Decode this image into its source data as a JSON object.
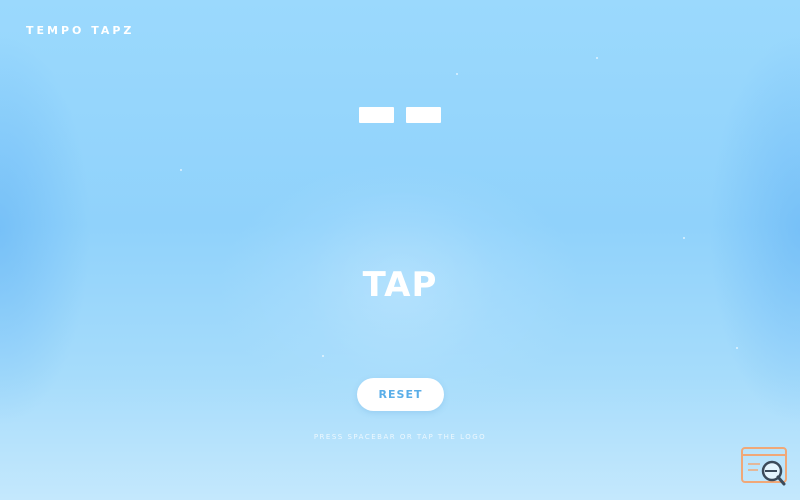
{
  "app": {
    "brand": "TEMPO TAPZ"
  },
  "display": {
    "digits": [
      "",
      ""
    ]
  },
  "tap": {
    "label": "TAP"
  },
  "controls": {
    "reset_label": "RESET"
  },
  "footer": {
    "hint": "PRESS SPACEBAR OR TAP THE LOGO"
  },
  "colors": {
    "background_top": "#9bd9fd",
    "background_bottom": "#c4e8fd",
    "accent": "#5aaee8",
    "text": "#ffffff"
  },
  "icons": {
    "corner": "search-icon"
  }
}
